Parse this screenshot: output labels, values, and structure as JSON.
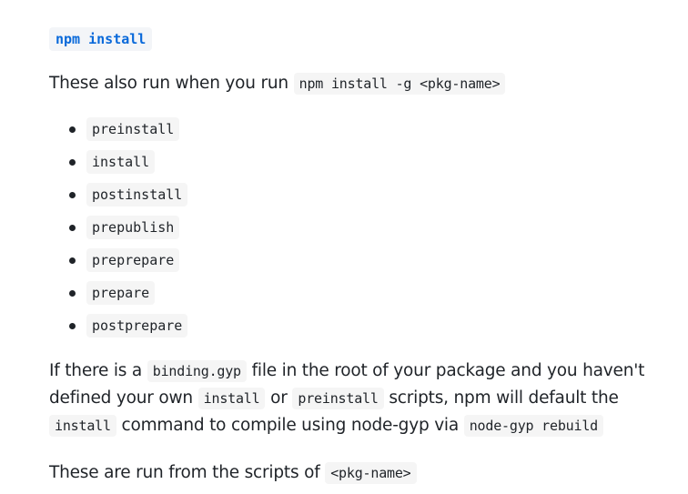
{
  "heading": {
    "code": "npm install"
  },
  "intro": {
    "text": "These also run when you run ",
    "code": "npm install -g <pkg-name>"
  },
  "scripts": [
    "preinstall",
    "install",
    "postinstall",
    "prepublish",
    "preprepare",
    "prepare",
    "postprepare"
  ],
  "note": {
    "t1": "If there is a ",
    "c1": "binding.gyp",
    "t2": " file in the root of your package and you haven't defined your own ",
    "c2": "install",
    "t3": " or ",
    "c3": "preinstall",
    "t4": " scripts, npm will default the ",
    "c4": "install",
    "t5": " command to compile using node-gyp via ",
    "c5": "node-gyp rebuild"
  },
  "footer": {
    "text": "These are run from the scripts of ",
    "code": "<pkg-name>"
  },
  "colors": {
    "text": "#1f2328",
    "heading_code": "#0969da",
    "code_bg": "#f5f5f5"
  }
}
